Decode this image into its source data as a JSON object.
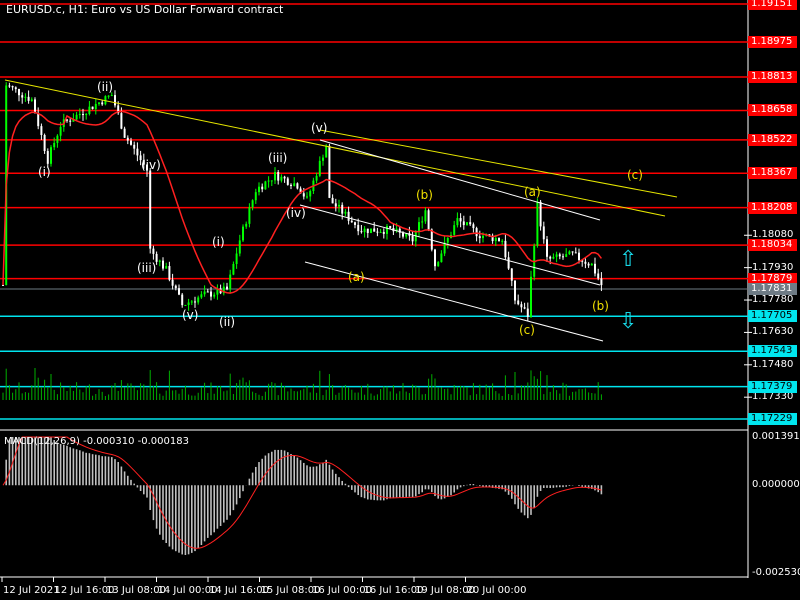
{
  "header": {
    "title": "EURUSD.c, H1:  Euro vs US Dollar Forward contract"
  },
  "macd": {
    "title": "MACD(12,26,9) -0.000310 -0.000183",
    "axis": [
      "0.001391",
      "0.000000",
      "-0.002530"
    ],
    "range": [
      -0.00253,
      0.001391
    ]
  },
  "colors": {
    "red_level": "#ff0000",
    "cyan_level": "#00e5ee",
    "bull": "#00ff00",
    "bear": "#ffffff",
    "ma": "#ff2020",
    "trend_yellow": "#e6e600",
    "trend_white": "#ffffff",
    "current": "#6e7b85"
  },
  "price_axis": {
    "range": [
      1.17229,
      1.19151
    ],
    "red_levels": [
      "1.19151",
      "1.18975",
      "1.18813",
      "1.18658",
      "1.18522",
      "1.18367",
      "1.18208",
      "1.18034",
      "1.17879"
    ],
    "cyan_levels": [
      "1.17705",
      "1.17543",
      "1.17379",
      "1.17229"
    ],
    "current": "1.17831",
    "ticks": [
      "1.18080",
      "1.17930",
      "1.17780",
      "1.17630",
      "1.17480",
      "1.17330"
    ]
  },
  "time_axis": [
    "12 Jul 2021",
    "12 Jul 16:00",
    "13 Jul 08:00",
    "14 Jul 00:00",
    "14 Jul 16:00",
    "15 Jul 08:00",
    "16 Jul 00:00",
    "16 Jul 16:00",
    "19 Jul 08:00",
    "20 Jul 00:00"
  ],
  "wave_labels": [
    "(i)",
    "(ii)",
    "(iii)",
    "(iv)",
    "(v)",
    "(i)",
    "(ii)",
    "(iii)",
    "(iv)",
    "(v)",
    "(a)",
    "(b)",
    "(c)",
    "(a)",
    "(b)",
    "(c)"
  ],
  "chart_data": {
    "type": "candlestick",
    "symbol": "EURUSD.c",
    "timeframe": "H1",
    "keypoints": [
      [
        1,
        1.18776
      ],
      [
        9,
        1.18707
      ],
      [
        14,
        1.18429
      ],
      [
        18,
        1.18591
      ],
      [
        34,
        1.1873
      ],
      [
        38,
        1.18544
      ],
      [
        45,
        1.18382
      ],
      [
        46,
        1.18012
      ],
      [
        51,
        1.17919
      ],
      [
        56,
        1.17757
      ],
      [
        63,
        1.17804
      ],
      [
        70,
        1.17827
      ],
      [
        74,
        1.18058
      ],
      [
        79,
        1.1829
      ],
      [
        85,
        1.18359
      ],
      [
        92,
        1.18313
      ],
      [
        95,
        1.18244
      ],
      [
        101,
        1.18498
      ],
      [
        102,
        1.18244
      ],
      [
        107,
        1.18174
      ],
      [
        112,
        1.18105
      ],
      [
        121,
        1.18105
      ],
      [
        128,
        1.18058
      ],
      [
        132,
        1.18197
      ],
      [
        135,
        1.17943
      ],
      [
        142,
        1.18151
      ],
      [
        149,
        1.18082
      ],
      [
        156,
        1.18058
      ],
      [
        160,
        1.17781
      ],
      [
        164,
        1.17711
      ],
      [
        167,
        1.1822
      ],
      [
        170,
        1.17966
      ],
      [
        178,
        1.17989
      ],
      [
        184,
        1.17943
      ],
      [
        187,
        1.1785
      ]
    ]
  }
}
